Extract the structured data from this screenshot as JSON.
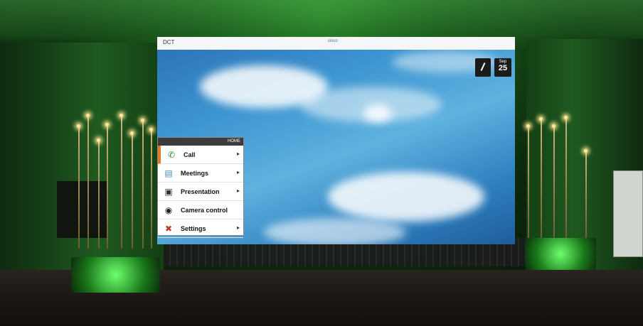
{
  "screen": {
    "topbar": {
      "left_text": "DCT",
      "brand": "cisco"
    },
    "widget": {
      "month": "Sep",
      "day": "25"
    },
    "menu": {
      "title": "HOME",
      "items": [
        {
          "label": "Call",
          "icon": "phone-icon",
          "has_submenu": true
        },
        {
          "label": "Meetings",
          "icon": "calendar-icon",
          "has_submenu": true
        },
        {
          "label": "Presentation",
          "icon": "laptop-icon",
          "has_submenu": true
        },
        {
          "label": "Camera control",
          "icon": "camera-icon",
          "has_submenu": false
        },
        {
          "label": "Settings",
          "icon": "tools-icon",
          "has_submenu": true
        }
      ]
    }
  },
  "colors": {
    "ambient_green": "#2fa53a",
    "menu_accent": "#e57a26",
    "sky_blue": "#3d95d1"
  }
}
